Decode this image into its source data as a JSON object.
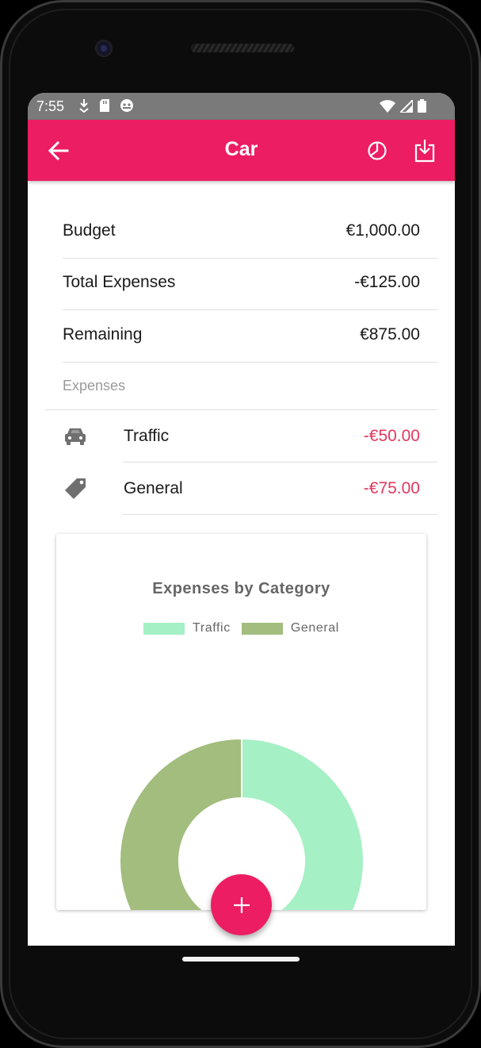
{
  "status_bar": {
    "time": "7:55"
  },
  "app_bar": {
    "title": "Car",
    "back_icon": "arrow-left-icon",
    "chart_icon": "pie-chart-icon",
    "download_icon": "download-icon",
    "color": "#ec1d63"
  },
  "summary": [
    {
      "label": "Budget",
      "value": "€1,000.00"
    },
    {
      "label": "Total Expenses",
      "value": "-€125.00"
    },
    {
      "label": "Remaining",
      "value": "€875.00"
    }
  ],
  "expenses": {
    "header": "Expenses",
    "items": [
      {
        "label": "Traffic",
        "amount": "-€50.00",
        "icon": "car-icon"
      },
      {
        "label": "General",
        "amount": "-€75.00",
        "icon": "tag-icon"
      }
    ],
    "amount_color": "#e2385e"
  },
  "chart_data": {
    "type": "pie",
    "title": "Expenses by Category",
    "categories": [
      "Traffic",
      "General"
    ],
    "values": [
      50,
      75
    ],
    "colors": [
      "#a5f0c5",
      "#a2bd7d"
    ],
    "legend": "top",
    "donut": true
  },
  "fab": {
    "icon": "plus-icon"
  }
}
